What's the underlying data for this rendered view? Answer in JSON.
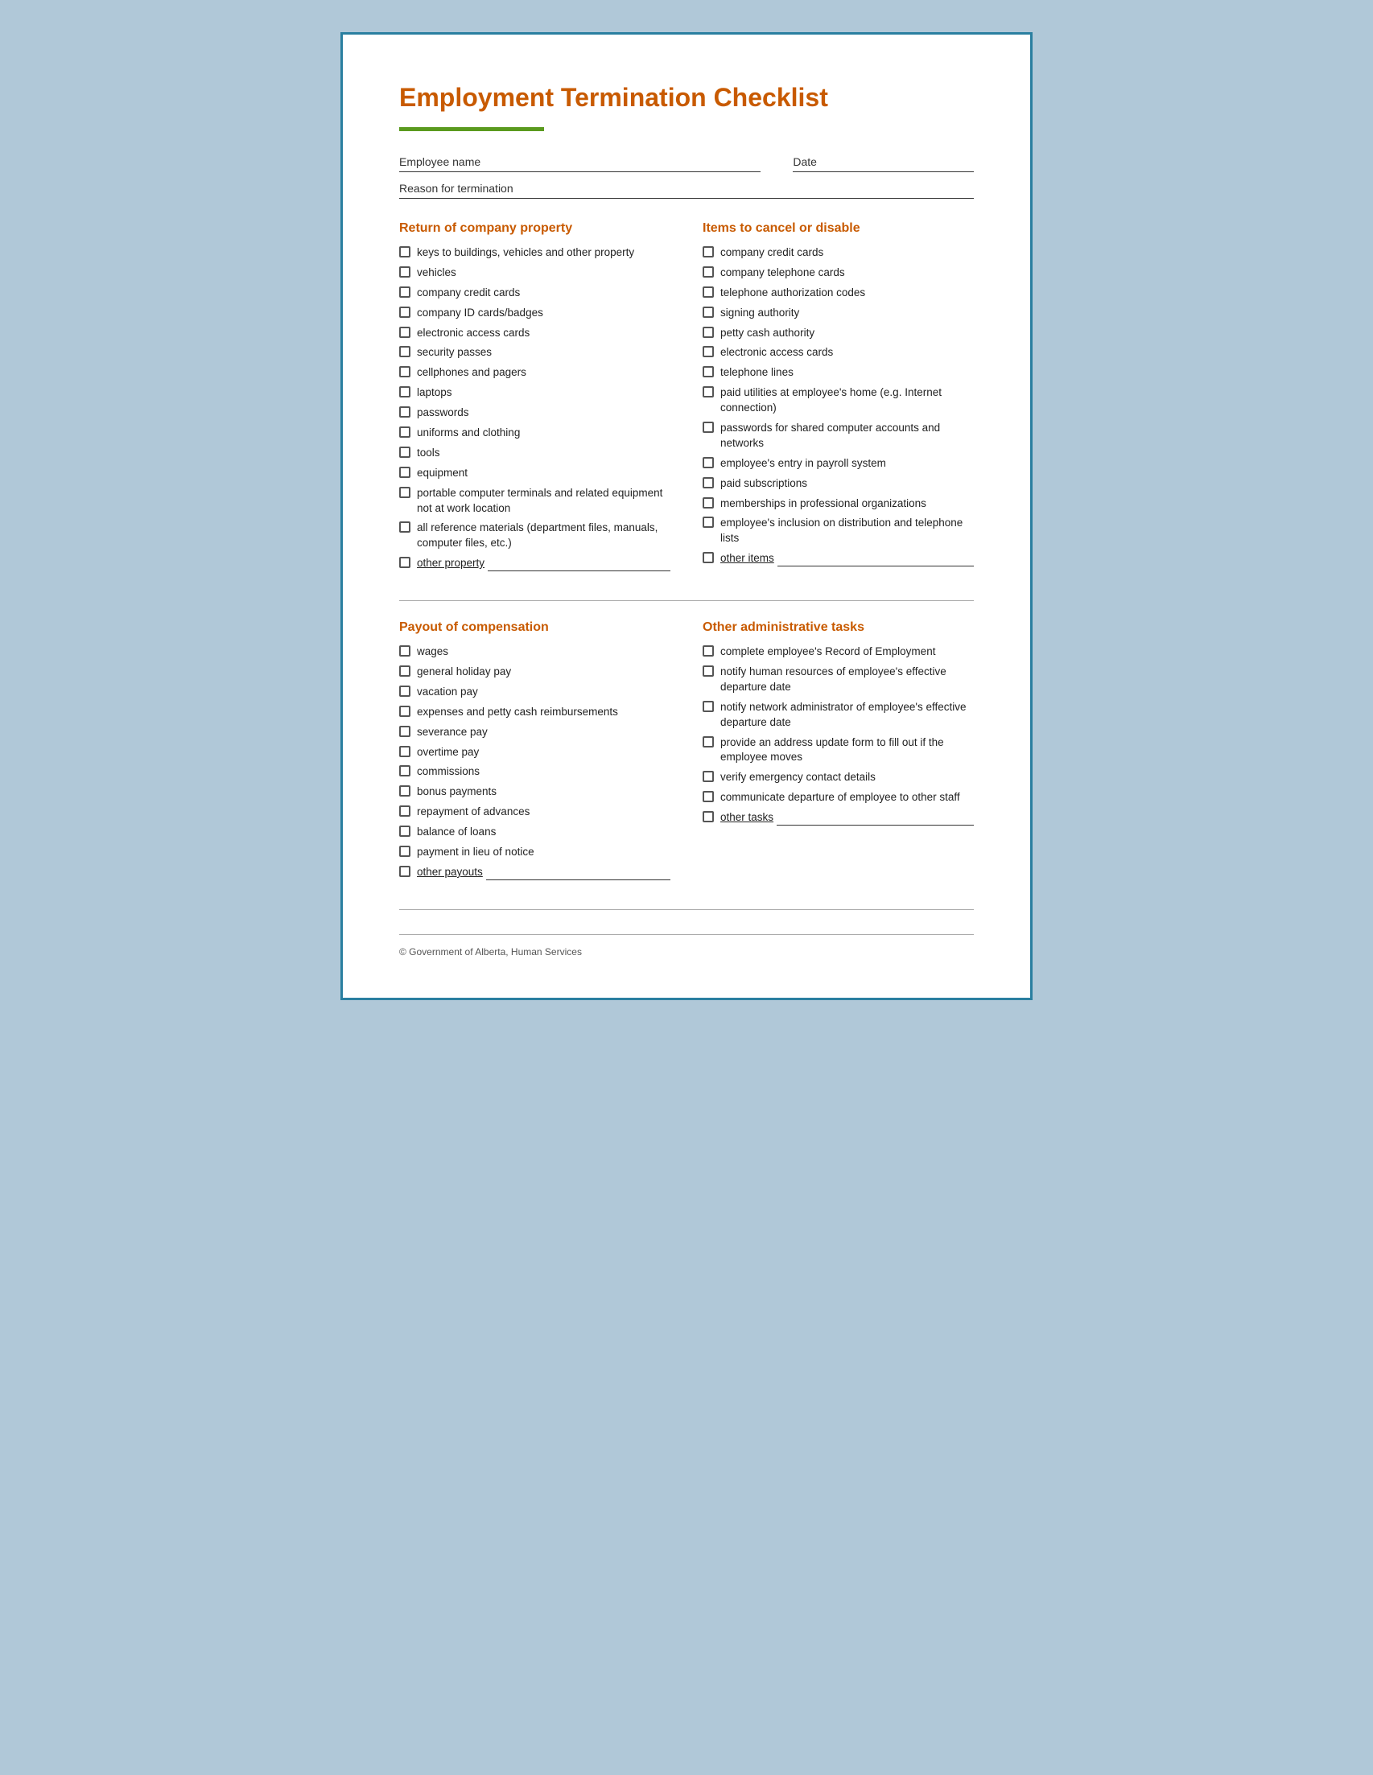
{
  "title": "Employment Termination Checklist",
  "fields": {
    "employee_name_label": "Employee name",
    "date_label": "Date",
    "reason_label": "Reason for termination"
  },
  "sections": {
    "left_top": {
      "title": "Return of company property",
      "items": [
        "keys to buildings, vehicles and other property",
        "vehicles",
        "company credit cards",
        "company ID cards/badges",
        "electronic access cards",
        "security passes",
        "cellphones and pagers",
        "laptops",
        "passwords",
        "uniforms and clothing",
        "tools",
        "equipment",
        "portable computer terminals and related equipment not at work location",
        "all reference materials (department files, manuals, computer files, etc.)",
        "other property"
      ],
      "other_index": 14
    },
    "right_top": {
      "title": "Items to cancel or disable",
      "items": [
        "company credit cards",
        "company telephone cards",
        "telephone authorization codes",
        "signing authority",
        "petty cash authority",
        "electronic access cards",
        "telephone lines",
        "paid utilities at employee's home (e.g. Internet connection)",
        "passwords for shared computer accounts and networks",
        "employee's entry in payroll system",
        "paid subscriptions",
        "memberships in professional organizations",
        "employee's inclusion on distribution and telephone lists",
        "other items"
      ],
      "other_index": 13
    },
    "left_bottom": {
      "title": "Payout of compensation",
      "items": [
        "wages",
        "general holiday pay",
        "vacation pay",
        "expenses and petty cash reimbursements",
        "severance pay",
        "overtime pay",
        "commissions",
        "bonus payments",
        "repayment of advances",
        "balance of loans",
        "payment in lieu of notice",
        "other payouts"
      ],
      "other_index": 11
    },
    "right_bottom": {
      "title": "Other administrative tasks",
      "items": [
        "complete employee's Record of Employment",
        "notify human resources of employee's effective departure date",
        "notify network administrator of employee's effective departure date",
        "provide an address update form to fill out if the employee moves",
        "verify emergency contact details",
        "communicate departure of employee to other staff",
        "other tasks"
      ],
      "other_index": 6
    }
  },
  "footer": "© Government of Alberta, Human Services"
}
